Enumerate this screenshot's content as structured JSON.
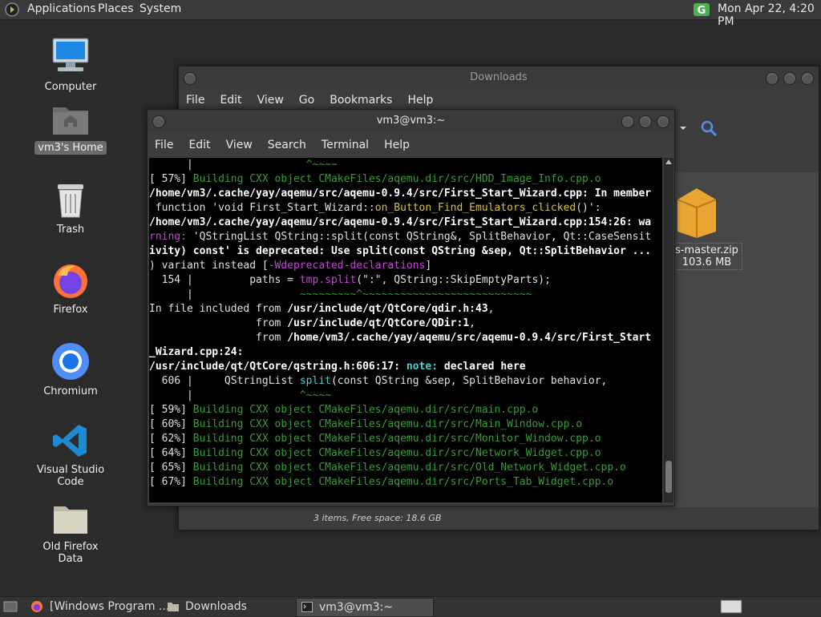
{
  "top_panel": {
    "menus": [
      "Applications",
      "Places",
      "System"
    ],
    "clock": "Mon Apr 22,  4:20 PM"
  },
  "desktop": [
    {
      "label": "Computer",
      "icon": "computer-icon"
    },
    {
      "label": "vm3's Home",
      "icon": "home-folder-icon"
    },
    {
      "label": "Trash",
      "icon": "trash-icon"
    },
    {
      "label": "Firefox",
      "icon": "firefox-icon"
    },
    {
      "label": "Chromium",
      "icon": "chromium-icon"
    },
    {
      "label": "Visual Studio Code",
      "icon": "vscode-icon"
    },
    {
      "label": "Old Firefox Data",
      "icon": "folder-icon"
    }
  ],
  "file_manager": {
    "title": "Downloads",
    "menu": [
      "File",
      "Edit",
      "View",
      "Go",
      "Bookmarks",
      "Help"
    ],
    "file_name": "s-master.zip",
    "file_size": "103.6 MB",
    "status": "3 items, Free space: 18.6 GB"
  },
  "terminal": {
    "title": "vm3@vm3:~",
    "menu": [
      "File",
      "Edit",
      "View",
      "Search",
      "Terminal",
      "Help"
    ],
    "lines": [
      "      |                  ^~~~~",
      "[ 57%] Building CXX object CMakeFiles/aqemu.dir/src/HDD_Image_Info.cpp.o",
      "/home/vm3/.cache/yay/aqemu/src/aqemu-0.9.4/src/First_Start_Wizard.cpp: In member",
      " function 'void First_Start_Wizard::on_Button_Find_Emulators_clicked()':",
      "/home/vm3/.cache/yay/aqemu/src/aqemu-0.9.4/src/First_Start_Wizard.cpp:154:26: wa",
      "rning: 'QStringList QString::split(const QString&, SplitBehavior, Qt::CaseSensit",
      "ivity) const' is deprecated: Use split(const QString &sep, Qt::SplitBehavior ...",
      ") variant instead [-Wdeprecated-declarations]",
      "  154 |         paths = tmp.split(\":\", QString::SkipEmptyParts);",
      "      |                 ~~~~~~~~~^~~~~~~~~~~~~~~~~~~~~~~~~~~~",
      "In file included from /usr/include/qt/QtCore/qdir.h:43,",
      "                 from /usr/include/qt/QtCore/QDir:1,",
      "                 from /home/vm3/.cache/yay/aqemu/src/aqemu-0.9.4/src/First_Start",
      "_Wizard.cpp:24:",
      "/usr/include/qt/QtCore/qstring.h:606:17: note: declared here",
      "  606 |     QStringList split(const QString &sep, SplitBehavior behavior,",
      "      |                 ^~~~~",
      "[ 59%] Building CXX object CMakeFiles/aqemu.dir/src/main.cpp.o",
      "[ 60%] Building CXX object CMakeFiles/aqemu.dir/src/Main_Window.cpp.o",
      "[ 62%] Building CXX object CMakeFiles/aqemu.dir/src/Monitor_Window.cpp.o",
      "[ 64%] Building CXX object CMakeFiles/aqemu.dir/src/Network_Widget.cpp.o",
      "[ 65%] Building CXX object CMakeFiles/aqemu.dir/src/Old_Network_Widget.cpp.o",
      "[ 67%] Building CXX object CMakeFiles/aqemu.dir/src/Ports_Tab_Widget.cpp.o"
    ]
  },
  "taskbar": {
    "items": [
      "[Windows Program ...",
      "Downloads",
      "vm3@vm3:~"
    ]
  },
  "colors": {
    "panel": "#3a3a3a",
    "terminal_bg": "#000000",
    "green": "#3a9a3a",
    "magenta": "#c04ad0",
    "cyan": "#4ad0d0",
    "yellow": "#d5c23a"
  }
}
